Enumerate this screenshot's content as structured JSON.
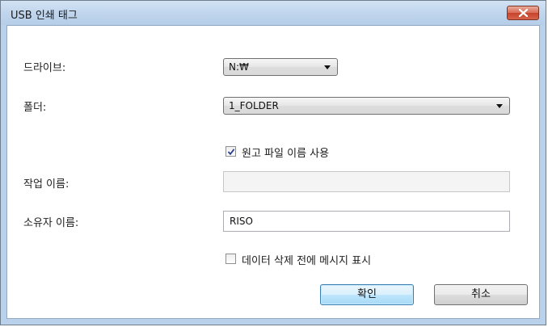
{
  "window": {
    "title": "USB 인쇄 태그"
  },
  "form": {
    "drive_label": "드라이브:",
    "drive_value": "N:₩",
    "folder_label": "폴더:",
    "folder_value": "1_FOLDER",
    "use_filename_label": "원고 파일 이름 사용",
    "use_filename_checked": true,
    "job_name_label": "작업 이름:",
    "job_name_value": "",
    "owner_label": "소유자 이름:",
    "owner_value": "RISO",
    "show_message_label": "데이터 삭제 전에 메시지 표시",
    "show_message_checked": false
  },
  "buttons": {
    "ok": "확인",
    "cancel": "취소"
  },
  "icons": {
    "close": "close-icon",
    "check": "checkmark-icon",
    "dropdown": "chevron-down-icon"
  }
}
